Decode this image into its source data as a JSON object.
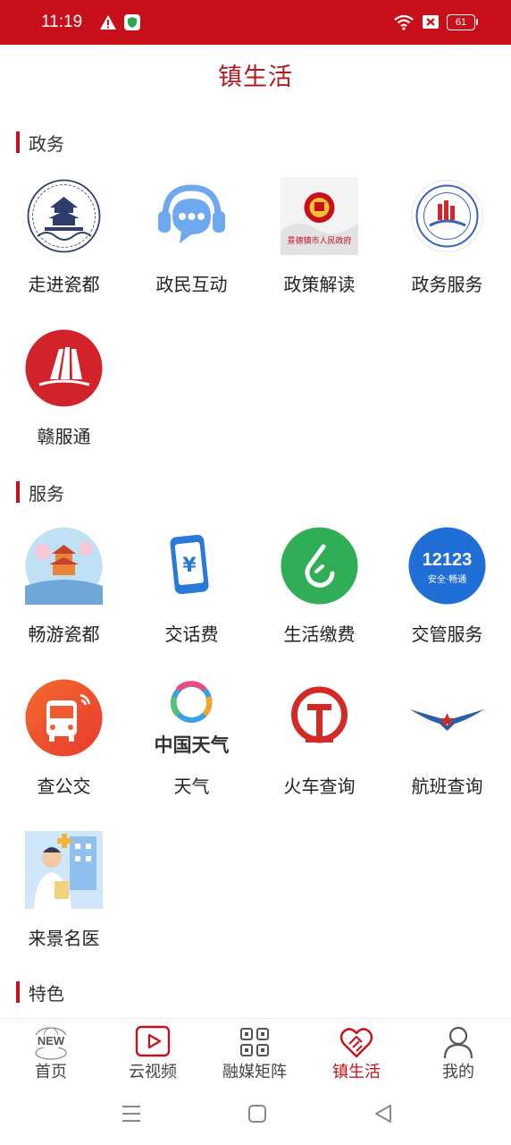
{
  "status_bar": {
    "time": "11:19",
    "battery": "61"
  },
  "header": {
    "title": "镇生活"
  },
  "sections": {
    "gov": {
      "title": "政务",
      "items": [
        {
          "label": "走进瓷都"
        },
        {
          "label": "政民互动"
        },
        {
          "label": "政策解读",
          "badge": "景德镇市人民政府"
        },
        {
          "label": "政务服务"
        },
        {
          "label": "赣服通"
        }
      ]
    },
    "service": {
      "title": "服务",
      "items": [
        {
          "label": "畅游瓷都"
        },
        {
          "label": "交话费"
        },
        {
          "label": "生活缴费"
        },
        {
          "label": "交管服务",
          "badge_top": "12123",
          "badge_bottom": "安全·畅通"
        },
        {
          "label": "查公交"
        },
        {
          "label": "天气",
          "badge": "中国天气"
        },
        {
          "label": "火车查询"
        },
        {
          "label": "航班查询"
        },
        {
          "label": "来景名医"
        }
      ]
    },
    "special": {
      "title": "特色"
    }
  },
  "tabbar": [
    {
      "label": "首页",
      "icon_text": "NEW"
    },
    {
      "label": "云视频"
    },
    {
      "label": "融媒矩阵"
    },
    {
      "label": "镇生活"
    },
    {
      "label": "我的"
    }
  ],
  "colors": {
    "brand": "#c8101a",
    "title": "#b21a1f"
  }
}
